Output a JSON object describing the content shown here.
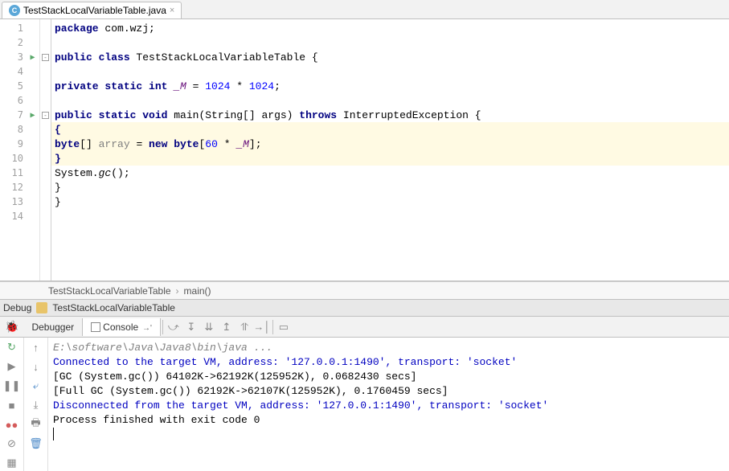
{
  "tab": {
    "filename": "TestStackLocalVariableTable.java"
  },
  "gutter": {
    "lines": [
      1,
      2,
      3,
      4,
      5,
      6,
      7,
      8,
      9,
      10,
      11,
      12,
      13,
      14
    ],
    "runnable": [
      3,
      7
    ]
  },
  "code": {
    "l1_kw1": "package",
    "l1_rest": " com.wzj;",
    "l3_kw1": "public class",
    "l3_name": " TestStackLocalVariableTable {",
    "l5_kw1": "private static int ",
    "l5_field": "_M",
    "l5_eq": " = ",
    "l5_n1": "1024",
    "l5_mul": " * ",
    "l5_n2": "1024",
    "l5_semi": ";",
    "l7_kw1": "public static void ",
    "l7_main": "main",
    "l7_p1": "(String[] args) ",
    "l7_kw2": "throws",
    "l7_exc": " InterruptedException {",
    "l8_brace": "{",
    "l9_kw1": "byte",
    "l9_arr": "[] ",
    "l9_var": "array",
    "l9_eq": " = ",
    "l9_kw2": "new byte",
    "l9_br1": "[",
    "l9_n": "60",
    "l9_mul": " * ",
    "l9_field": "_M",
    "l9_br2": "];",
    "l10_brace": "}",
    "l11_sys": "System.",
    "l11_gc": "gc",
    "l11_call": "();",
    "l12_brace": "}",
    "l13_brace": "}"
  },
  "breadcrumb": {
    "class": "TestStackLocalVariableTable",
    "method": "main()"
  },
  "debug": {
    "label": "Debug",
    "config": "TestStackLocalVariableTable"
  },
  "toolbar": {
    "tab_debugger": "Debugger",
    "tab_console": "Console"
  },
  "console": {
    "l1": "E:\\software\\Java\\Java8\\bin\\java ...",
    "l2": "Connected to the target VM, address: '127.0.0.1:1490', transport: 'socket'",
    "l3": "[GC (System.gc())  64102K->62192K(125952K), 0.0682430 secs]",
    "l4": "[Full GC (System.gc())  62192K->62107K(125952K), 0.1760459 secs]",
    "l5": "Disconnected from the target VM, address: '127.0.0.1:1490', transport: 'socket'",
    "l6": "",
    "l7": "Process finished with exit code 0"
  }
}
